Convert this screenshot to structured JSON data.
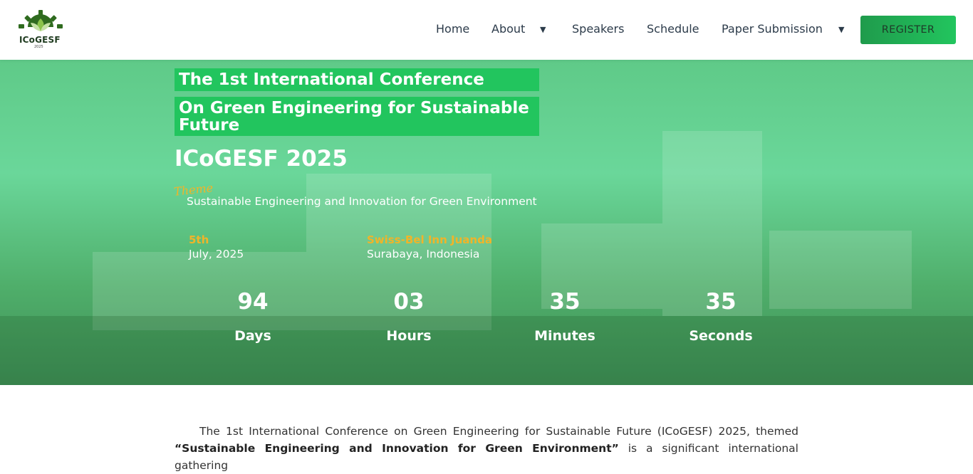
{
  "header": {
    "logo_text": "ICoGESF",
    "logo_year": "2025",
    "nav": [
      {
        "label": "Home"
      },
      {
        "label": "About"
      },
      {
        "label": "Speakers"
      },
      {
        "label": "Schedule"
      },
      {
        "label": "Paper Submission"
      }
    ],
    "register_label": "REGISTER"
  },
  "hero": {
    "title_line1": "The 1st International Conference",
    "title_line2": "On Green Engineering for Sustainable Future",
    "acronym": "ICoGESF 2025",
    "theme_label": "Theme",
    "theme_text": "Sustainable Engineering and Innovation for Green Environment",
    "date_label": "5th",
    "date_value": "July, 2025",
    "venue_label": "Swiss-Bel Inn Juanda",
    "venue_value": "Surabaya, Indonesia",
    "countdown": [
      {
        "value": "94",
        "label": "Days"
      },
      {
        "value": "03",
        "label": "Hours"
      },
      {
        "value": "35",
        "label": "Minutes"
      },
      {
        "value": "35",
        "label": "Seconds"
      }
    ]
  },
  "intro": {
    "text_start": "The 1st International Conference on Green Engineering for Sustainable Future (ICoGESF) 2025, themed",
    "text_bold": "“Sustainable Engineering and Innovation for Green Environment”",
    "text_end": "is a significant international gathering"
  },
  "colors": {
    "accent_green": "#22c55e",
    "highlight_yellow": "#f0b429",
    "register_gradient": [
      "#1f9b4c",
      "#22c55e"
    ]
  }
}
